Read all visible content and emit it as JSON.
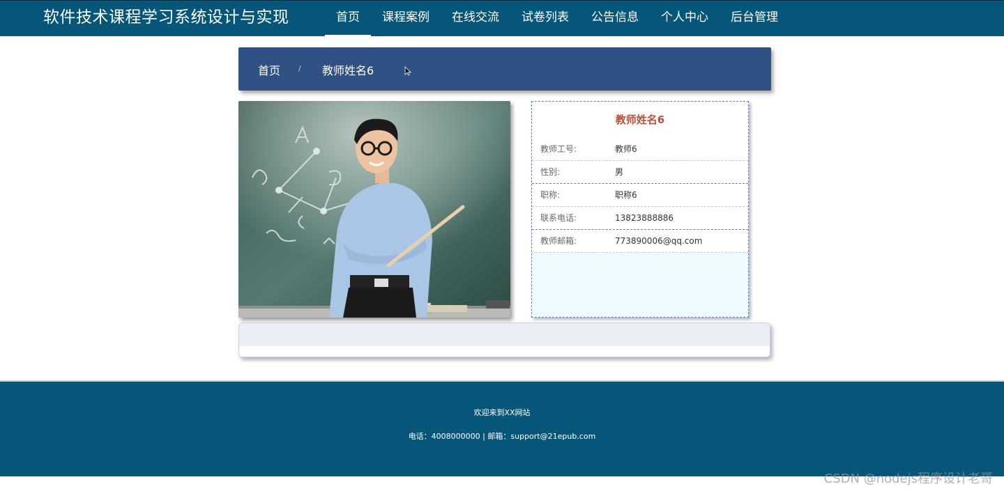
{
  "site_title": "软件技术课程学习系统设计与实现",
  "nav": [
    {
      "label": "首页",
      "active": true
    },
    {
      "label": "课程案例"
    },
    {
      "label": "在线交流"
    },
    {
      "label": "试卷列表"
    },
    {
      "label": "公告信息"
    },
    {
      "label": "个人中心"
    },
    {
      "label": "后台管理"
    }
  ],
  "breadcrumb": {
    "home": "首页",
    "separator": "/",
    "current": "教师姓名6"
  },
  "teacher": {
    "name": "教师姓名6",
    "fields": [
      {
        "label": "教师工号:",
        "value": "教师6"
      },
      {
        "label": "性别:",
        "value": "男"
      },
      {
        "label": "职称:",
        "value": "职称6"
      },
      {
        "label": "联系电话:",
        "value": "13823888886"
      },
      {
        "label": "教师邮箱:",
        "value": "773890006@qq.com"
      }
    ]
  },
  "footer": {
    "welcome": "欢迎来到XX网站",
    "contact": "电话：4008000000 | 邮箱：support@21epub.com"
  },
  "watermark": "CSDN @nodejs程序设计老哥",
  "colors": {
    "header_bg": "#06567a",
    "breadcrumb_bg": "#2f5183",
    "teacher_name": "#b5513c",
    "info_bg": "#eefcff"
  }
}
